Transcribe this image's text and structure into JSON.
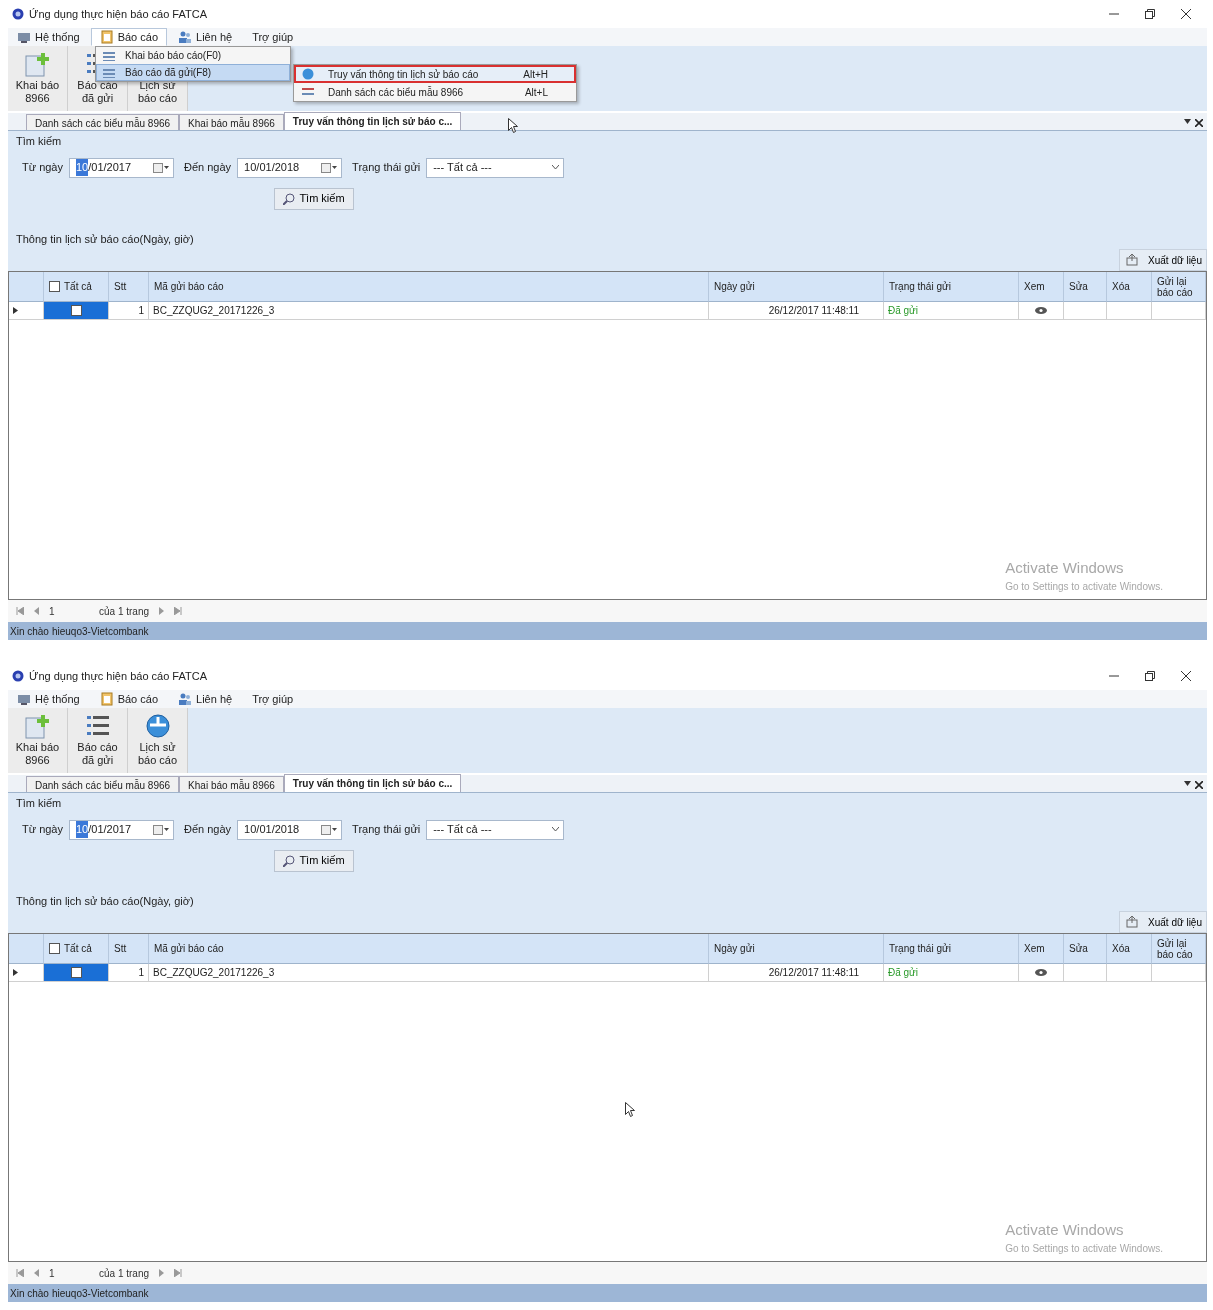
{
  "screens": [
    {
      "window": {
        "title": "Ứng dụng thực hiện báo cáo FATCA"
      },
      "menu": [
        {
          "label": "Hệ thống",
          "selected": false
        },
        {
          "label": "Báo cáo",
          "selected": true
        },
        {
          "label": "Liên hệ",
          "selected": false
        },
        {
          "label": "Trợ giúp",
          "selected": false
        }
      ],
      "dropdown": {
        "items": [
          {
            "label": "Khai báo báo cáo(F0)",
            "selected": false
          },
          {
            "label": "Báo cáo đã gửi(F8)",
            "selected": true
          }
        ],
        "submenu": [
          {
            "label": "Truy vấn thông tin lịch sử báo cáo",
            "shortcut": "Alt+H",
            "selected": true
          },
          {
            "label": "Danh sách các biểu mẫu 8966",
            "shortcut": "Alt+L",
            "selected": false
          }
        ]
      },
      "ribbon": [
        {
          "lines": [
            "Khai báo",
            "8966"
          ]
        },
        {
          "lines": [
            "Báo cáo",
            "đã gửi"
          ]
        },
        {
          "lines": [
            "Lịch sử",
            "báo cáo"
          ]
        }
      ],
      "tabs": [
        {
          "label": "Danh sách các biểu mẫu 8966",
          "selected": false
        },
        {
          "label": "Khai báo mẫu 8966",
          "selected": false
        },
        {
          "label": "Truy vấn thông tin lịch sử báo c...",
          "selected": true
        }
      ],
      "search": {
        "group": "Tìm kiếm",
        "from_label": "Từ ngày",
        "from_value": "10/01/2017",
        "to_label": "Đến ngày",
        "to_value": "10/01/2018",
        "status_label": "Trạng thái gửi",
        "status_value": "--- Tất cả ---",
        "button": "Tìm kiếm"
      },
      "history_label": "Thông tin lịch sử báo cáo(Ngày, giờ)",
      "export_button": "Xuất dữ liệu",
      "table": {
        "columns": [
          "Tất cả",
          "Stt",
          "Mã gửi báo cáo",
          "Ngày gửi",
          "Trạng thái gửi",
          "Xem",
          "Sửa",
          "Xóa",
          "Gửi lại báo cáo"
        ],
        "header_checked": false,
        "rows": [
          {
            "checked": false,
            "stt": "1",
            "code": "BC_ZZQUG2_20171226_3",
            "date": "26/12/2017 11:48:11",
            "status": "Đã gửi"
          }
        ]
      },
      "pager": {
        "page": "1",
        "of_pages": "của 1 trang"
      },
      "activation": {
        "title": "Activate Windows",
        "hint": "Go to Settings to activate Windows."
      },
      "status_bar": {
        "greeting": "Xin chào",
        "user": "hieuqo3-Vietcombank"
      }
    },
    {
      "window": {
        "title": "Ứng dụng thực hiện báo cáo FATCA"
      },
      "menu": [
        {
          "label": "Hệ thống",
          "selected": false
        },
        {
          "label": "Báo cáo",
          "selected": false
        },
        {
          "label": "Liên hệ",
          "selected": false
        },
        {
          "label": "Trợ giúp",
          "selected": false
        }
      ],
      "ribbon": [
        {
          "lines": [
            "Khai báo",
            "8966"
          ]
        },
        {
          "lines": [
            "Báo cáo",
            "đã gửi"
          ]
        },
        {
          "lines": [
            "Lịch sử",
            "báo cáo"
          ]
        }
      ],
      "tabs": [
        {
          "label": "Danh sách các biểu mẫu 8966",
          "selected": false
        },
        {
          "label": "Khai báo mẫu 8966",
          "selected": false
        },
        {
          "label": "Truy vấn thông tin lịch sử báo c...",
          "selected": true
        }
      ],
      "search": {
        "group": "Tìm kiếm",
        "from_label": "Từ ngày",
        "from_value": "10/01/2017",
        "to_label": "Đến ngày",
        "to_value": "10/01/2018",
        "status_label": "Trạng thái gửi",
        "status_value": "--- Tất cả ---",
        "button": "Tìm kiếm"
      },
      "history_label": "Thông tin lịch sử báo cáo(Ngày, giờ)",
      "export_button": "Xuất dữ liệu",
      "table": {
        "columns": [
          "Tất cả",
          "Stt",
          "Mã gửi báo cáo",
          "Ngày gửi",
          "Trạng thái gửi",
          "Xem",
          "Sửa",
          "Xóa",
          "Gửi lại báo cáo"
        ],
        "header_checked": false,
        "rows": [
          {
            "checked": false,
            "stt": "1",
            "code": "BC_ZZQUG2_20171226_3",
            "date": "26/12/2017 11:48:11",
            "status": "Đã gửi"
          }
        ]
      },
      "pager": {
        "page": "1",
        "of_pages": "của 1 trang"
      },
      "activation": {
        "title": "Activate Windows",
        "hint": "Go to Settings to activate Windows."
      },
      "status_bar": {
        "greeting": "Xin chào",
        "user": "hieuqo3-Vietcombank"
      }
    }
  ]
}
